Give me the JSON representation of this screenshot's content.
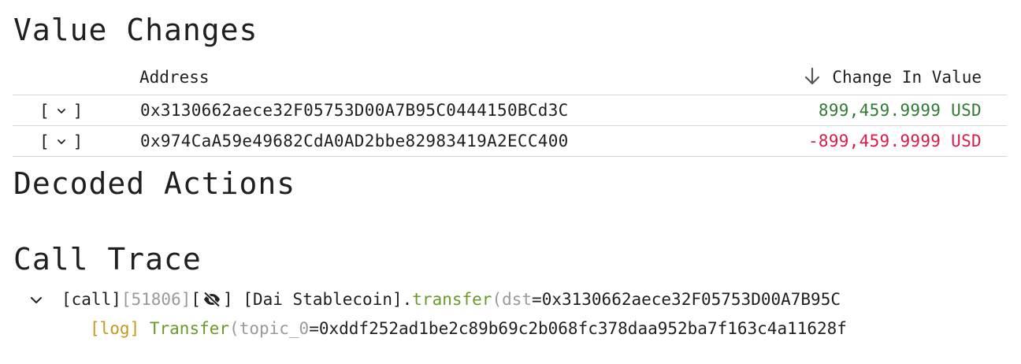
{
  "sections": {
    "value_changes": "Value Changes",
    "decoded_actions": "Decoded Actions",
    "call_trace": "Call Trace"
  },
  "table": {
    "headers": {
      "address": "Address",
      "change": "Change In Value"
    },
    "rows": [
      {
        "expand": "[",
        "expand_close": "]",
        "address": "0x3130662aece32F05753D00A7B95C0444150BCd3C",
        "value": "899,459.9999 USD",
        "sign": "positive"
      },
      {
        "expand": "[",
        "expand_close": "]",
        "address": "0x974CaA59e49682CdA0AD2bbe82983419A2ECC400",
        "value": "-899,459.9999 USD",
        "sign": "negative"
      }
    ]
  },
  "trace": {
    "call": {
      "type": "[call]",
      "gas": "[51806]",
      "bracket_open": "[",
      "bracket_close": "]",
      "contract": "[Dai Stablecoin].",
      "method": "transfer",
      "paren": "(",
      "param_name": "dst",
      "eq": "=",
      "param_value": "0x3130662aece32F05753D00A7B95C"
    },
    "log": {
      "type": "[log]",
      "event": "Transfer",
      "paren": "(",
      "param_name": "topic_0",
      "eq": "=",
      "param_value": "0xddf252ad1be2c89b69c2b068fc378daa952ba7f163c4a11628f"
    }
  },
  "colors": {
    "positive": "#2e7d32",
    "negative": "#d81b4a",
    "method": "#6a9a2a",
    "log": "#c49a1a",
    "muted": "#9a9a9a"
  },
  "icons": {
    "sort": "arrow-down-icon",
    "expand": "chevron-down-icon",
    "hidden": "eye-off-icon"
  }
}
